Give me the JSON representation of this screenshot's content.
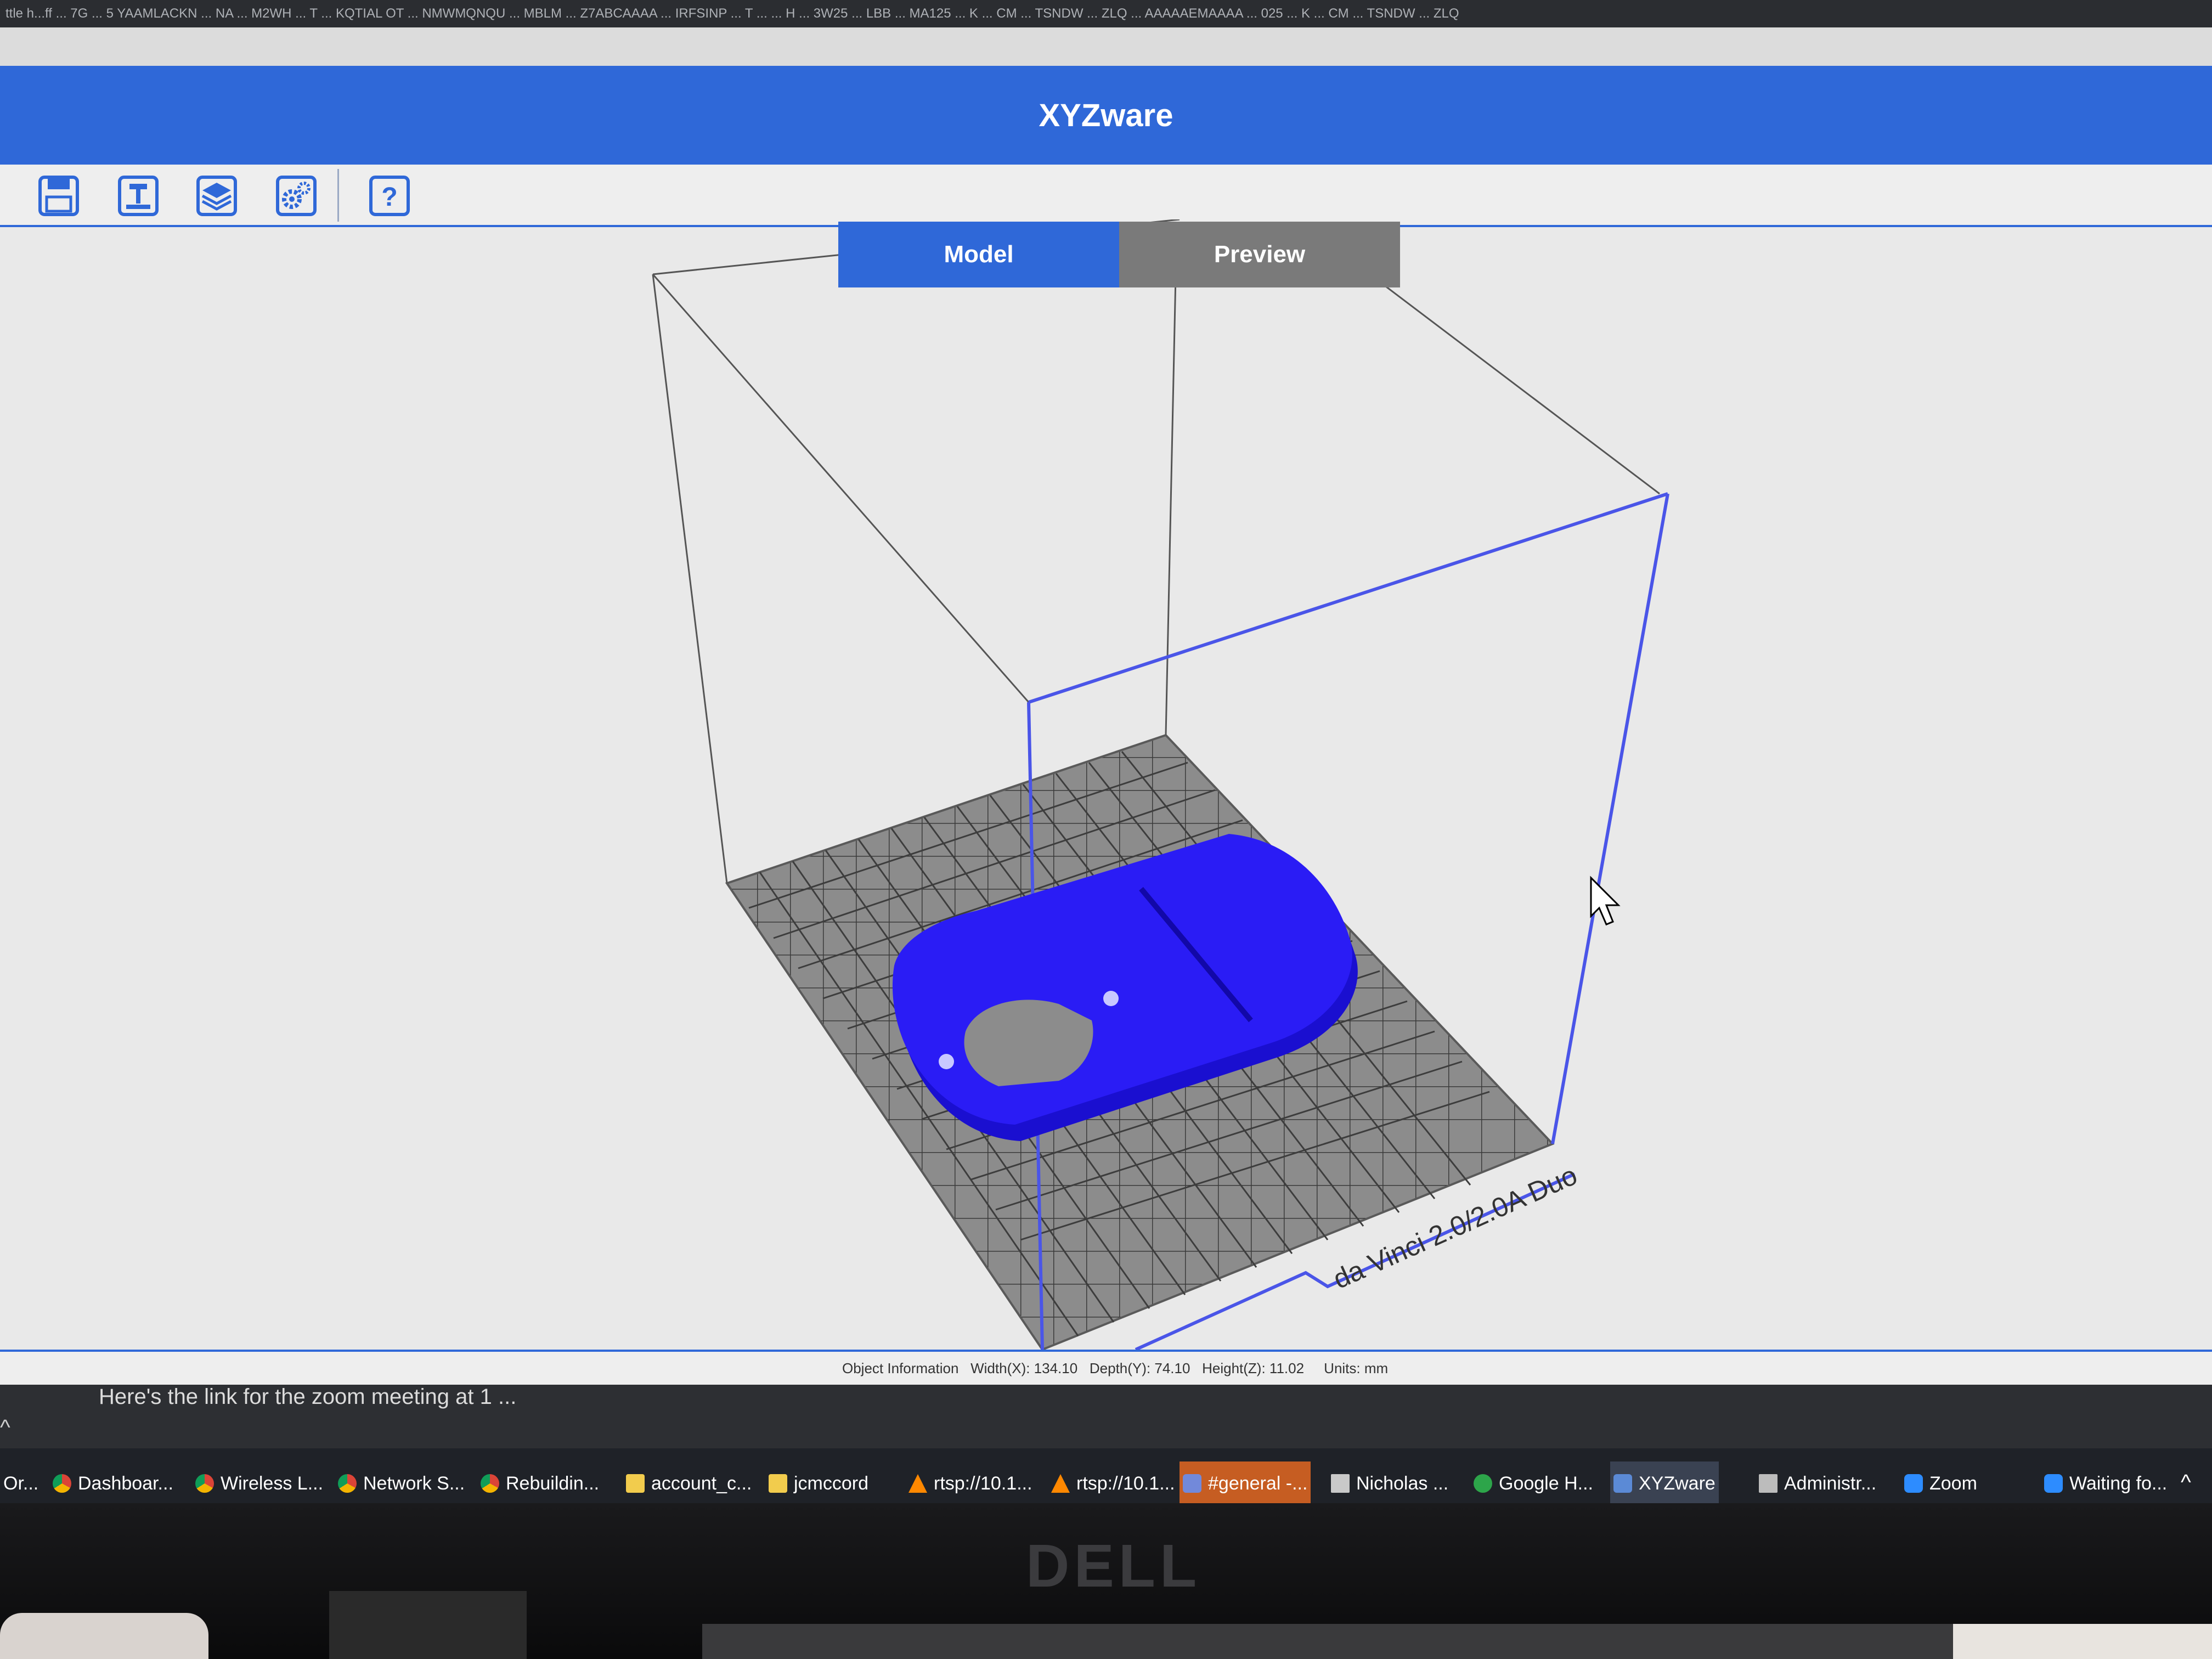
{
  "app": {
    "title": "XYZware",
    "browser_strip_text": "ttle h...ff ... 7G ... 5 YAAMLACKN ... NA ... M2WH ... T ... KQTIAL OT ... NMWMQNQU ... MBLM ... Z7ABCAAAA ... IRFSINP ... T ... ... H ... 3W25 ... LBB ... MA125 ... K ... CM ... TSNDW ... ZLQ ... AAAAAEMAAAA ... 025 ... K ... CM ... TSNDW ... ZLQ"
  },
  "toolbar": {
    "items": [
      {
        "name": "save-icon",
        "glyph": "💾"
      },
      {
        "name": "print-icon",
        "glyph": "⊥"
      },
      {
        "name": "layers-icon",
        "glyph": "≋"
      },
      {
        "name": "settings-icon",
        "glyph": "⚙"
      },
      {
        "name": "help-icon",
        "glyph": "?"
      }
    ]
  },
  "tabs": {
    "model_label": "Model",
    "preview_label": "Preview",
    "active": "Model"
  },
  "viewport": {
    "printer_label": "da Vinci 2.0/2.0A Duo",
    "model_color": "#1f14f2",
    "bed_color": "#8a8a8a",
    "frame_color": "#4a55e8"
  },
  "status": {
    "label": "Object Information",
    "width": "Width(X): 134.10",
    "depth": "Depth(Y): 74.10",
    "height": "Height(Z): 11.02",
    "units": "Units: mm"
  },
  "notification": {
    "text": "Here's the link for the zoom meeting at 1 ..."
  },
  "taskbar": {
    "items": [
      {
        "label": "Or...",
        "icon": "chrome-icon",
        "color": "#e8a23a"
      },
      {
        "label": "Dashboar...",
        "icon": "chrome-icon",
        "color": "#e8a23a"
      },
      {
        "label": "Wireless L...",
        "icon": "chrome-icon",
        "color": "#e8a23a"
      },
      {
        "label": "Network S...",
        "icon": "chrome-icon",
        "color": "#e8a23a"
      },
      {
        "label": "Rebuildin...",
        "icon": "chrome-icon",
        "color": "#e8a23a"
      },
      {
        "label": "account_c...",
        "icon": "folder-icon",
        "color": "#f2cc4d"
      },
      {
        "label": "jcmccord",
        "icon": "folder-icon",
        "color": "#f2cc4d"
      },
      {
        "label": "rtsp://10.1...",
        "icon": "vlc-icon",
        "color": "#ff8800"
      },
      {
        "label": "rtsp://10.1...",
        "icon": "vlc-icon",
        "color": "#ff8800"
      },
      {
        "label": "#general -...",
        "icon": "discord-icon",
        "color": "#7289da"
      },
      {
        "label": "Nicholas ...",
        "icon": "document-icon",
        "color": "#c9c9c9"
      },
      {
        "label": "Google H...",
        "icon": "hangouts-icon",
        "color": "#2da54a"
      },
      {
        "label": "XYZware",
        "icon": "xyzware-icon",
        "color": "#5b8ad6"
      },
      {
        "label": "Administr...",
        "icon": "terminal-icon",
        "color": "#bcbcbc"
      },
      {
        "label": "Zoom",
        "icon": "zoom-icon",
        "color": "#2d8cff"
      },
      {
        "label": "Waiting fo...",
        "icon": "zoom-icon",
        "color": "#2d8cff"
      }
    ]
  },
  "bezel": {
    "brand": "DELL"
  }
}
